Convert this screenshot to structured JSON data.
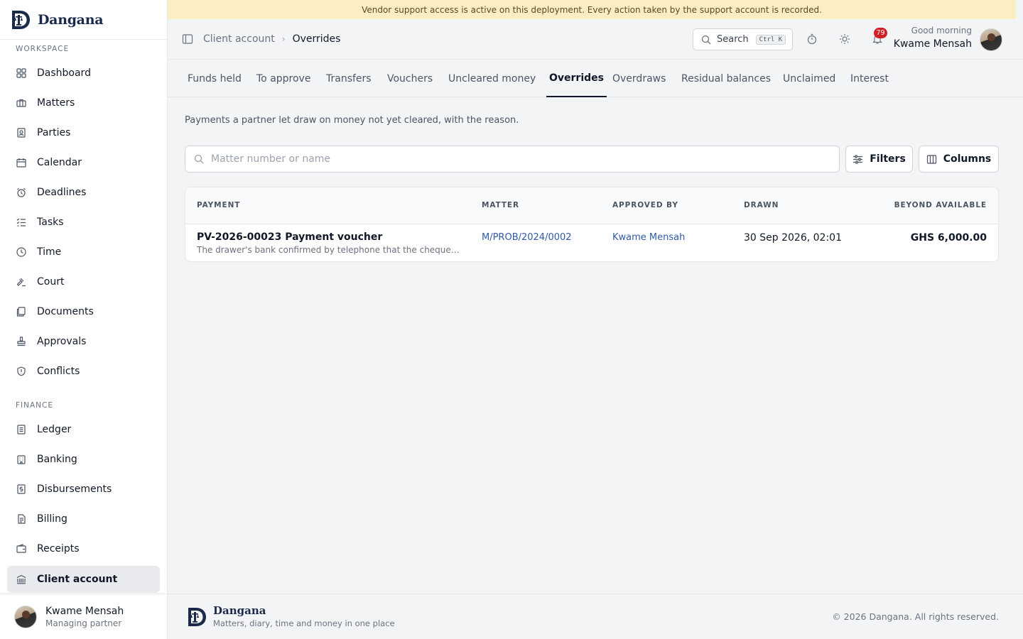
{
  "brand": {
    "name": "Dangana",
    "tagline": "Matters, diary, time and money in one place"
  },
  "banner": {
    "text": "Vendor support access is active on this deployment. Every action taken by the support account is recorded."
  },
  "sidebar": {
    "workspace_title": "WORKSPACE",
    "finance_title": "FINANCE",
    "workspace_items": [
      {
        "label": "Dashboard",
        "icon": "dashboard-icon"
      },
      {
        "label": "Matters",
        "icon": "briefcase-icon"
      },
      {
        "label": "Parties",
        "icon": "contact-card-icon"
      },
      {
        "label": "Calendar",
        "icon": "calendar-icon"
      },
      {
        "label": "Deadlines",
        "icon": "alarm-clock-icon"
      },
      {
        "label": "Tasks",
        "icon": "checklist-icon"
      },
      {
        "label": "Time",
        "icon": "clock-icon"
      },
      {
        "label": "Court",
        "icon": "gavel-icon"
      },
      {
        "label": "Documents",
        "icon": "documents-icon"
      },
      {
        "label": "Approvals",
        "icon": "stamp-icon"
      },
      {
        "label": "Conflicts",
        "icon": "shield-icon"
      }
    ],
    "finance_items": [
      {
        "label": "Ledger",
        "icon": "ledger-icon"
      },
      {
        "label": "Banking",
        "icon": "bank-building-icon"
      },
      {
        "label": "Disbursements",
        "icon": "dollar-receipt-icon"
      },
      {
        "label": "Billing",
        "icon": "invoice-icon"
      },
      {
        "label": "Receipts",
        "icon": "wallet-icon"
      },
      {
        "label": "Client account",
        "icon": "landmark-icon"
      }
    ],
    "user": {
      "name": "Kwame Mensah",
      "role": "Managing partner"
    }
  },
  "topbar": {
    "breadcrumb": [
      "Client account",
      "Overrides"
    ],
    "search_label": "Search",
    "search_shortcut": "Ctrl K",
    "notification_count": "79",
    "greeting": "Good morning",
    "user_name": "Kwame Mensah"
  },
  "tabs": [
    "Funds held",
    "To approve",
    "Transfers",
    "Vouchers",
    "Uncleared money",
    "Overrides",
    "Overdraws",
    "Residual balances",
    "Unclaimed",
    "Interest"
  ],
  "active_tab": "Overrides",
  "main": {
    "description": "Payments a partner let draw on money not yet cleared, with the reason.",
    "search_placeholder": "Matter number or name",
    "filters_label": "Filters",
    "columns_label": "Columns"
  },
  "table": {
    "headers": {
      "payment": "PAYMENT",
      "matter": "MATTER",
      "approved_by": "APPROVED BY",
      "drawn": "DRAWN",
      "beyond": "BEYOND AVAILABLE"
    },
    "rows": [
      {
        "payment": "PV-2026-00023 Payment voucher",
        "reason": "The drawer's bank confirmed by telephone that the cheque is g...",
        "matter": "M/PROB/2024/0002",
        "approved_by": "Kwame Mensah",
        "drawn": "30 Sep 2026, 02:01",
        "beyond": "GHS 6,000.00"
      }
    ]
  },
  "footer": {
    "copyright": "© 2026 Dangana. All rights reserved."
  }
}
